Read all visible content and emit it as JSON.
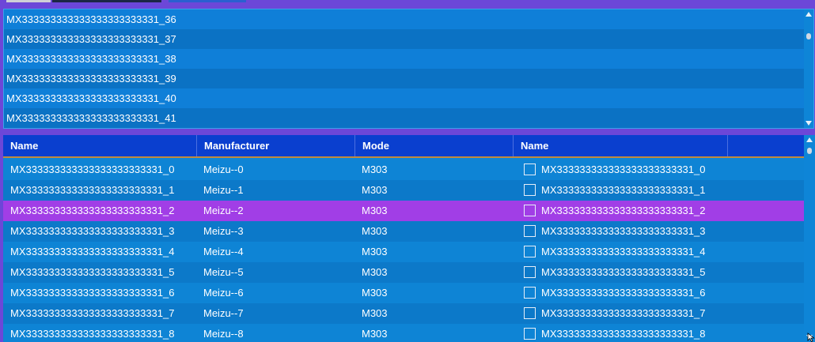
{
  "list": {
    "items": [
      "MX333333333333333333333331_36",
      "MX333333333333333333333331_37",
      "MX333333333333333333333331_38",
      "MX333333333333333333333331_39",
      "MX333333333333333333333331_40",
      "MX333333333333333333333331_41"
    ]
  },
  "grid": {
    "headers": [
      "Name",
      "Manufacturer",
      "Mode",
      "Name"
    ],
    "selected_index": 2,
    "rows": [
      {
        "name": "MX333333333333333333333331_0",
        "manufacturer": "Meizu--0",
        "mode": "M303",
        "check_name": "MX333333333333333333333331_0",
        "checked": false
      },
      {
        "name": "MX333333333333333333333331_1",
        "manufacturer": "Meizu--1",
        "mode": "M303",
        "check_name": "MX333333333333333333333331_1",
        "checked": false
      },
      {
        "name": "MX333333333333333333333331_2",
        "manufacturer": "Meizu--2",
        "mode": "M303",
        "check_name": "MX333333333333333333333331_2",
        "checked": false
      },
      {
        "name": "MX333333333333333333333331_3",
        "manufacturer": "Meizu--3",
        "mode": "M303",
        "check_name": "MX333333333333333333333331_3",
        "checked": false
      },
      {
        "name": "MX333333333333333333333331_4",
        "manufacturer": "Meizu--4",
        "mode": "M303",
        "check_name": "MX333333333333333333333331_4",
        "checked": false
      },
      {
        "name": "MX333333333333333333333331_5",
        "manufacturer": "Meizu--5",
        "mode": "M303",
        "check_name": "MX333333333333333333333331_5",
        "checked": false
      },
      {
        "name": "MX333333333333333333333331_6",
        "manufacturer": "Meizu--6",
        "mode": "M303",
        "check_name": "MX333333333333333333333331_6",
        "checked": false
      },
      {
        "name": "MX333333333333333333333331_7",
        "manufacturer": "Meizu--7",
        "mode": "M303",
        "check_name": "MX333333333333333333333331_7",
        "checked": false
      },
      {
        "name": "MX333333333333333333333331_8",
        "manufacturer": "Meizu--8",
        "mode": "M303",
        "check_name": "MX333333333333333333333331_8",
        "checked": false
      }
    ]
  },
  "colors": {
    "background": "#6c47d8",
    "list_bg": "#0e85d7",
    "header_bg": "#0a3fcf",
    "header_underline": "#c08a3e",
    "selected_row": "#a13ee6",
    "text": "#ffffff"
  },
  "icons": [
    "scroll-up-arrow-icon",
    "scroll-down-arrow-icon",
    "checkbox-icon"
  ]
}
